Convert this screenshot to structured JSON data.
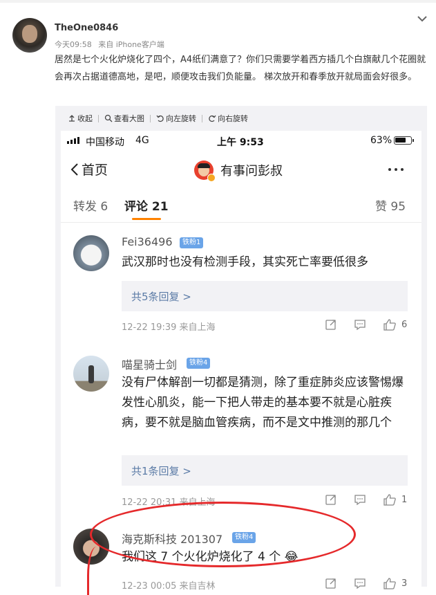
{
  "post": {
    "username": "TheOne0846",
    "time": "今天09:58",
    "source": "来自 iPhone客户端",
    "text": "居然是七个火化炉烧化了四个，A4纸们满意了？你们只需要学着西方插几个白旗献几个花圈就会再次占据道德高地，是吧，顺便攻击我们负能量。 梯次放开和春季放开就局面会好很多。"
  },
  "image_toolbar": {
    "collapse": "收起",
    "view_large": "查看大图",
    "rotate_left": "向左旋转",
    "rotate_right": "向右旋转"
  },
  "statusbar": {
    "carrier": "中国移动",
    "network": "4G",
    "time": "上午 9:53",
    "battery": "63%",
    "battery_level": 0.63
  },
  "navbar": {
    "back_label": "首页",
    "title": "有事问彭叔"
  },
  "tabs": {
    "reposts": {
      "label": "转发",
      "count": "6"
    },
    "comments": {
      "label": "评论",
      "count": "21"
    },
    "likes": {
      "label": "赞",
      "count": "95"
    }
  },
  "comments": [
    {
      "name": "Fei36496",
      "badge": "铁粉1",
      "text": "武汉那时也没有检测手段，其实死亡率要低很多",
      "replies": "共5条回复 >",
      "time": "12-22 19:39",
      "location": "来自上海",
      "likes": "6"
    },
    {
      "name": "喵星骑士剑",
      "badge": "铁粉4",
      "text": "没有尸体解剖一切都是猜测，除了重症肺炎应该警惕爆发性心肌炎，能一下把人带走的基本要不就是心脏疾病，要不就是脑血管疾病，而不是文中推测的那几个",
      "replies": "共1条回复 >",
      "time": "12-22 20:31",
      "location": "来自上海",
      "likes": "1"
    },
    {
      "name": "海克斯科技 201307",
      "badge": "铁粉4",
      "text": "我们这 7 个火化炉烧化了 4 个",
      "emoji": "😂",
      "time": "12-23 00:05",
      "location": "来自吉林",
      "likes": "3"
    }
  ],
  "colors": {
    "accent": "#ff8200",
    "link": "#5b7ba6",
    "badge": "#6aa4e8",
    "annotation": "#e5292b"
  }
}
